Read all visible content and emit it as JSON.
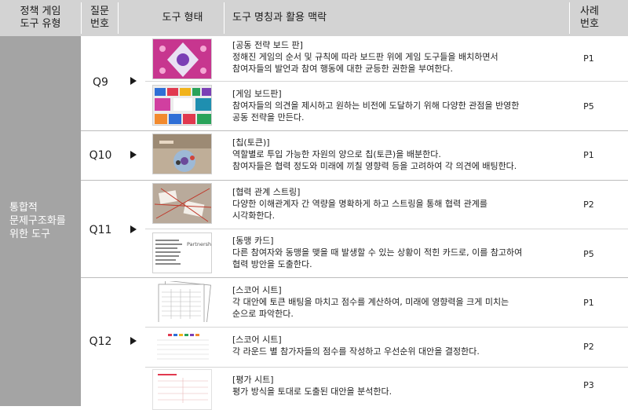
{
  "header": {
    "type_col": "정책 게임\n도구 유형",
    "question_col": "질문\n번호",
    "form_col": "도구 형태",
    "name_col": "도구 명칭과 활용 맥락",
    "case_col": "사례\n번호"
  },
  "category_label": "통합적\n문제구조화를\n위한 도구",
  "groups": [
    {
      "q": "Q9"
    },
    {
      "q": "Q10"
    },
    {
      "q": "Q11"
    },
    {
      "q": "Q12"
    }
  ],
  "rows": [
    {
      "title": "[공동 전략 보드 판]",
      "line1": "정해진 게임의 순서 및 규칙에 따라 보드판 위에 게임 도구들을 배치하면서",
      "line2": "참여자들의 발언과 참여 행동에 대한 균등한 권한을 부여한다.",
      "case": "P1"
    },
    {
      "title": "[게임 보드판]",
      "line1": "참여자들의 의견을 제시하고 원하는 비전에 도달하기 위해 다양한 관점을 반영한",
      "line2": "공동 전략을 만든다.",
      "case": "P5"
    },
    {
      "title": "[칩(토큰)]",
      "line1": "역할별로 투입 가능한 자원의 양으로 칩(토큰)을 배분한다.",
      "line2": "참여자들은 협력 정도와 미래에 끼칠 영향력 등을 고려하여 각 의견에 배팅한다.",
      "case": "P1"
    },
    {
      "title": "[협력 관계 스트링]",
      "line1": "다양한 이해관계자 간 역량을 명확하게 하고 스트링을 통해 협력 관계를",
      "line2": "시각화한다.",
      "case": "P2"
    },
    {
      "title": "[동맹 카드]",
      "line1": "다른 참여자와 동맹을 맺을 때 발생할 수 있는 상황이 적힌 카드로, 이를 참고하여",
      "line2": "협력 방안을 도출한다.",
      "case": "P5",
      "card_label": "Partnership"
    },
    {
      "title": "[스코어 시트]",
      "line1": "각 대안에 토큰 배팅을 마치고 점수를 계산하여, 미래에 영향력을 크게 미치는",
      "line2": "순으로 파악한다.",
      "case": "P1"
    },
    {
      "title": "[스코어 시트]",
      "line1": "각 라운드 별 참가자들의 점수를 작성하고 우선순위 대안을 결정한다.",
      "line2": "",
      "case": "P2"
    },
    {
      "title": "[평가 시트]",
      "line1": "평가 방식을 토대로 도출된 대안을 분석한다.",
      "line2": "",
      "case": "P3"
    }
  ]
}
